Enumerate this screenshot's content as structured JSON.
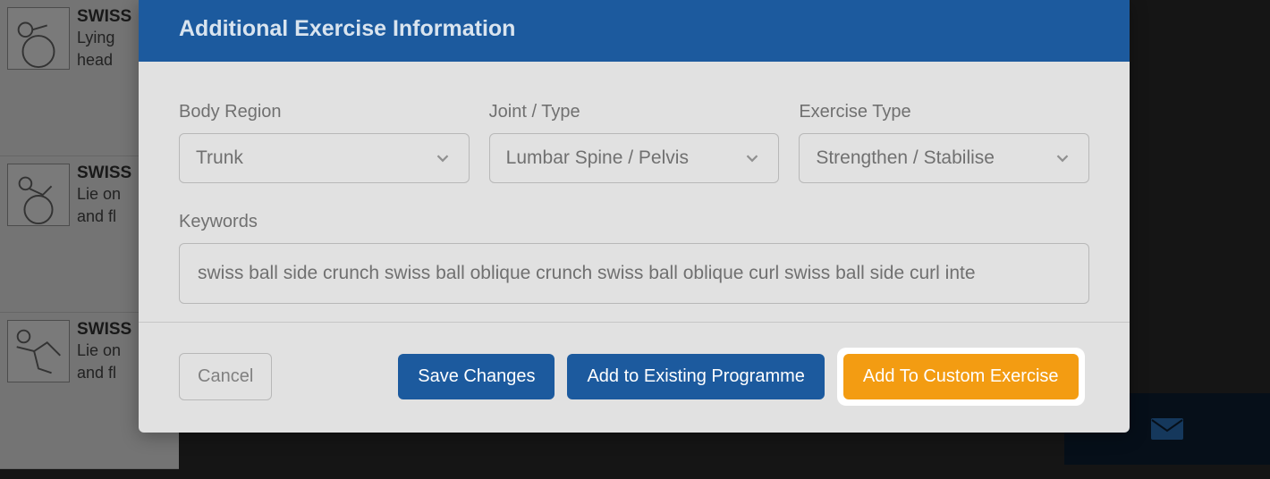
{
  "background": {
    "exercises": [
      {
        "title": "SWISS",
        "desc_line1": "Lying",
        "desc_line2": "head"
      },
      {
        "title": "SWISS",
        "desc_line1": "Lie on",
        "desc_line2": "and fl"
      },
      {
        "title": "SWISS",
        "desc_line1": "Lie on",
        "desc_line2": "and fl"
      }
    ]
  },
  "modal": {
    "title": "Additional Exercise Information",
    "fields": {
      "body_region": {
        "label": "Body Region",
        "value": "Trunk"
      },
      "joint_type": {
        "label": "Joint / Type",
        "value": "Lumbar Spine / Pelvis"
      },
      "exercise_type": {
        "label": "Exercise Type",
        "value": "Strengthen / Stabilise"
      },
      "keywords": {
        "label": "Keywords",
        "value": "swiss ball side crunch swiss ball oblique crunch swiss ball oblique curl swiss ball side curl inte"
      }
    },
    "buttons": {
      "cancel": "Cancel",
      "save": "Save Changes",
      "add_existing": "Add to Existing Programme",
      "add_custom": "Add To Custom Exercise"
    }
  }
}
